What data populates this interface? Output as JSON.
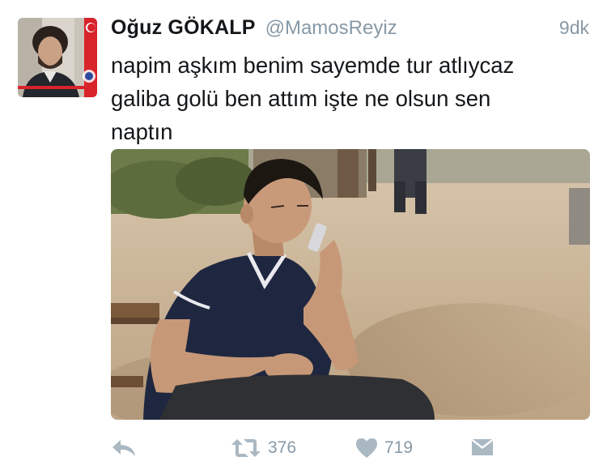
{
  "tweet": {
    "display_name": "Oğuz GÖKALP",
    "handle": "@MamosReyiz",
    "time": "9dk",
    "text": "napim aşkım benim sayemde tur atlıycaz\ngaliba golü ben attım işte ne olsun sen\nnaptın"
  },
  "actions": {
    "reply_icon": "reply-icon",
    "retweet_icon": "retweet-icon",
    "retweet_count": "376",
    "like_icon": "heart-icon",
    "like_count": "719",
    "dm_icon": "direct-message-icon"
  },
  "colors": {
    "text": "#14171a",
    "secondary": "#8899a6",
    "icon": "#aab8c2"
  }
}
